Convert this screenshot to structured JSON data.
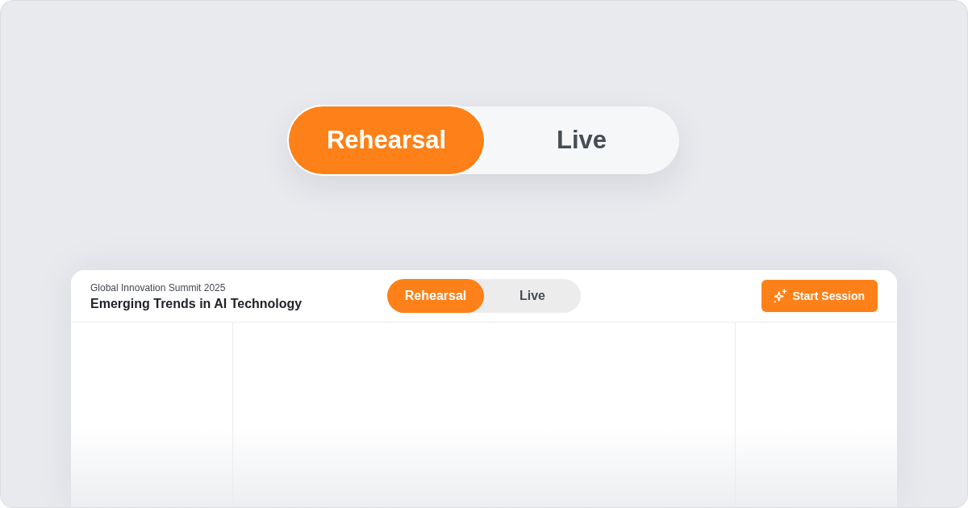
{
  "hero_toggle": {
    "options": [
      {
        "label": "Rehearsal",
        "selected": true
      },
      {
        "label": "Live",
        "selected": false
      }
    ]
  },
  "card": {
    "header": {
      "event": "Global Innovation Summit 2025",
      "title": "Emerging Trends in AI Technology",
      "mode_toggle": {
        "options": [
          {
            "label": "Rehearsal",
            "selected": true
          },
          {
            "label": "Live",
            "selected": false
          }
        ]
      },
      "start_button": {
        "label": "Start Session"
      }
    }
  }
}
